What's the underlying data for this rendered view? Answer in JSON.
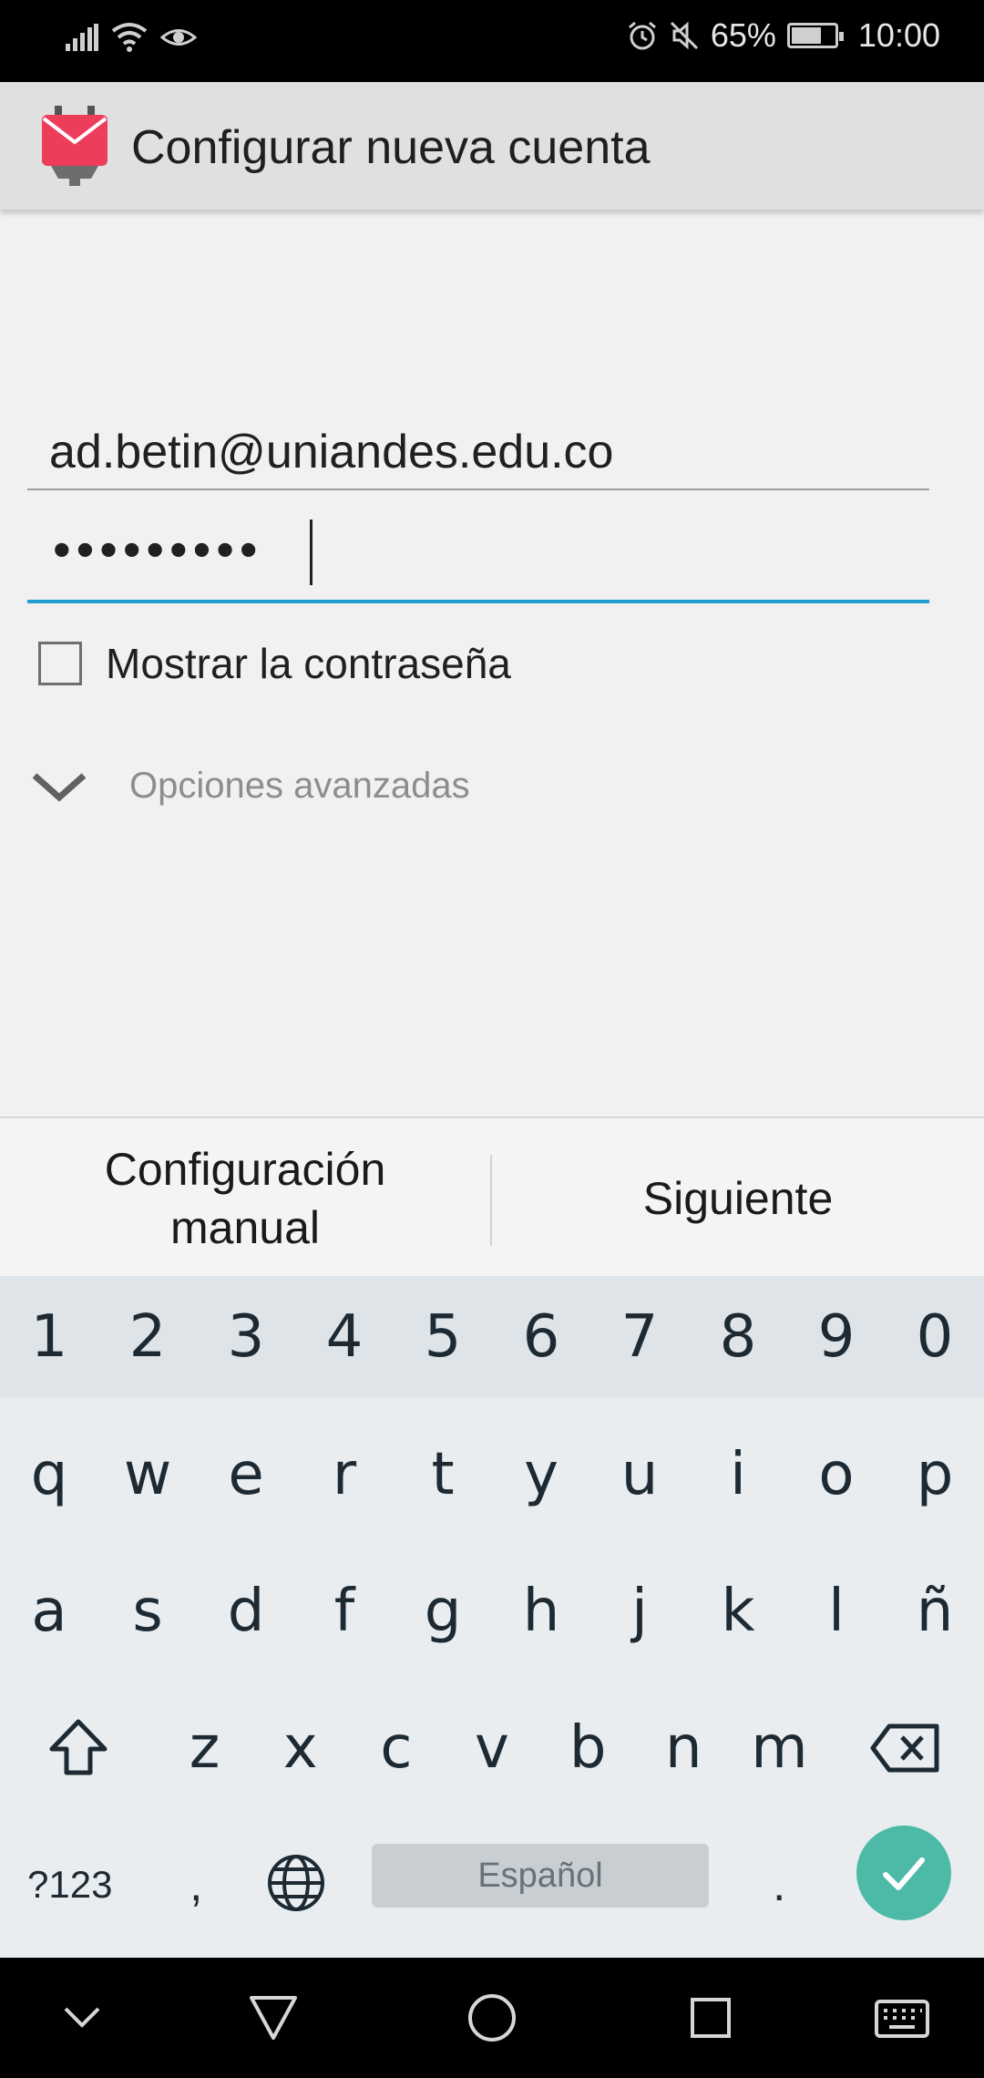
{
  "status_bar": {
    "battery_percent": "65%",
    "time": "10:00",
    "icons": [
      "signal-icon",
      "wifi-icon",
      "eye-icon",
      "alarm-icon",
      "mute-icon",
      "battery-icon"
    ],
    "battery_level": 0.65
  },
  "app_bar": {
    "title": "Configurar nueva cuenta",
    "logo": "app-mail-logo"
  },
  "form": {
    "email_value": "ad.betin@uniandes.edu.co",
    "password_mask": "•••••••••",
    "show_password_label": "Mostrar la contraseña",
    "show_password_checked": false,
    "advanced_label": "Opciones avanzadas"
  },
  "actions": {
    "manual_label": "Configuración\nmanual",
    "next_label": "Siguiente"
  },
  "keyboard": {
    "numbers": [
      "1",
      "2",
      "3",
      "4",
      "5",
      "6",
      "7",
      "8",
      "9",
      "0"
    ],
    "row_q": [
      "q",
      "w",
      "e",
      "r",
      "t",
      "y",
      "u",
      "i",
      "o",
      "p"
    ],
    "row_a": [
      "a",
      "s",
      "d",
      "f",
      "g",
      "h",
      "j",
      "k",
      "l",
      "ñ"
    ],
    "row_z": [
      "z",
      "x",
      "c",
      "v",
      "b",
      "n",
      "m"
    ],
    "symbols_label": "?123",
    "comma_label": ",",
    "space_label": "Español",
    "period_label": ".",
    "accent_color": "#4dbaa7"
  },
  "colors": {
    "accent_underline": "#1e9fd0",
    "logo_red": "#ee3d5a"
  }
}
